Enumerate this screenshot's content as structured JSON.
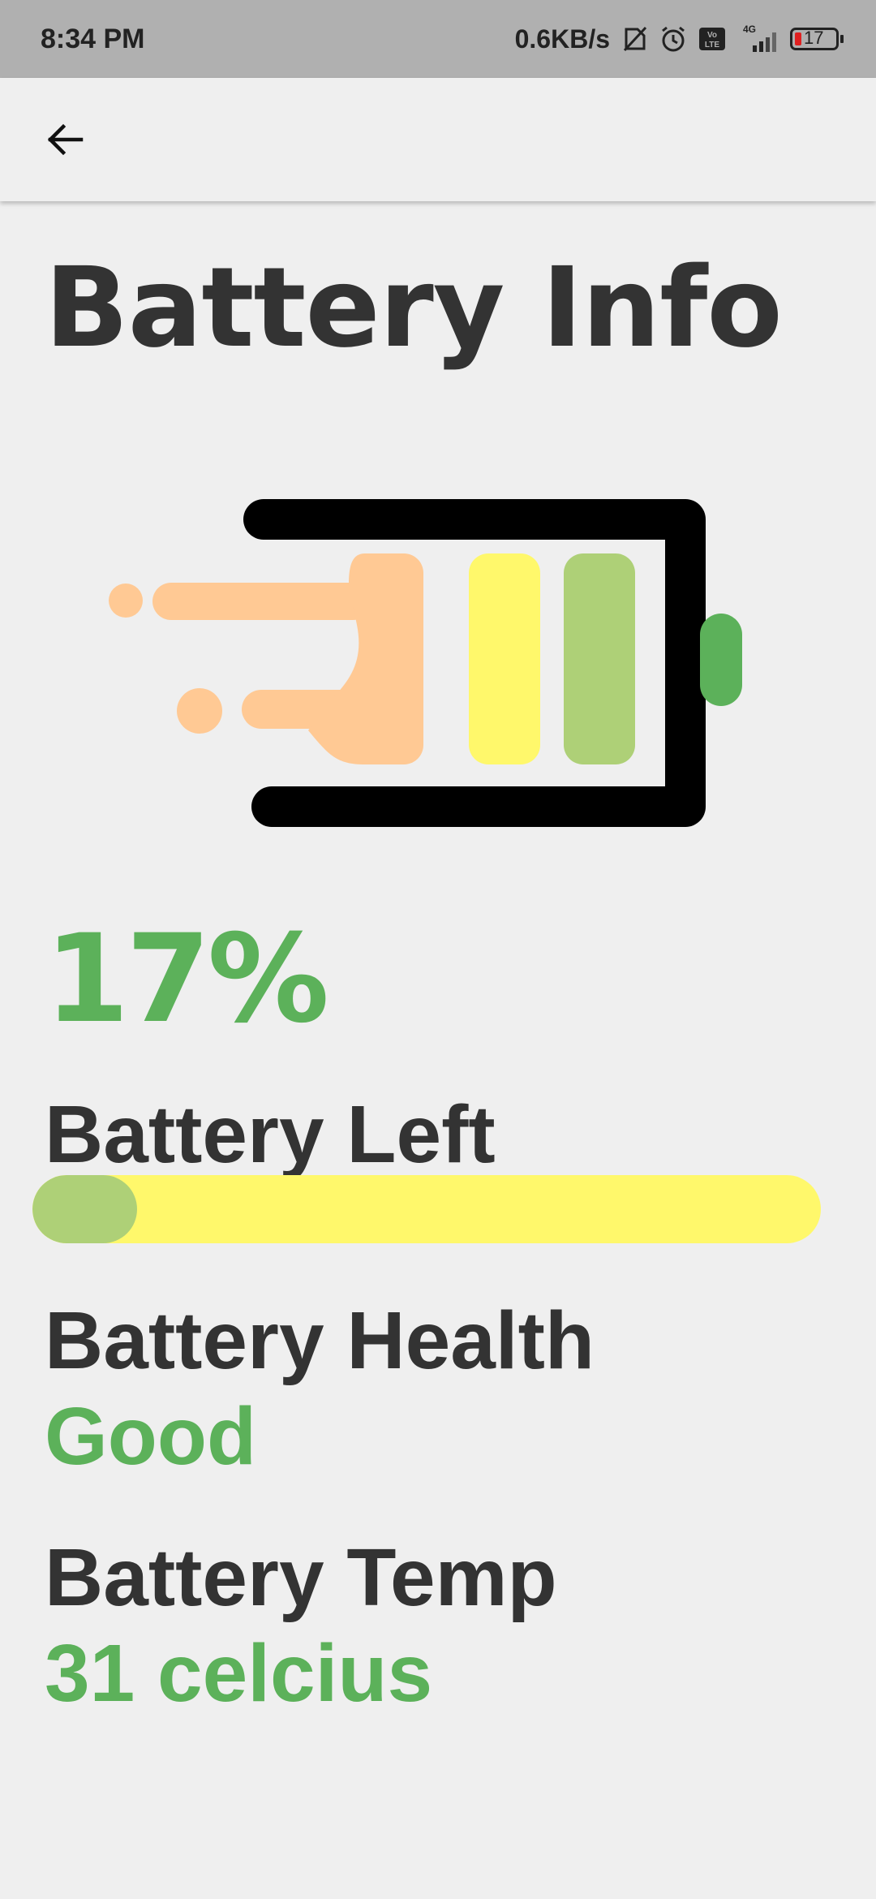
{
  "status_bar": {
    "time": "8:34 PM",
    "network_speed": "0.6KB/s",
    "network_type": "4G",
    "volte_label": "Vo LTE",
    "battery_level": "17",
    "icons": [
      "no-sim-icon",
      "alarm-icon",
      "volte-icon",
      "signal-icon",
      "battery-icon"
    ]
  },
  "app_bar": {
    "back_icon": "arrow-left-icon"
  },
  "page": {
    "title": "Battery Info"
  },
  "battery": {
    "percent_text": "17%",
    "percent_fraction": 0.17,
    "left_label": "Battery Left",
    "health_label": "Battery Health",
    "health_value": "Good",
    "temp_label": "Battery Temp",
    "temp_value": "31 celcius"
  },
  "colors": {
    "accent_green": "#5cb15a",
    "bar_track_yellow": "#fff86b",
    "bar_fill_green": "#aed077",
    "title_gray": "#333333",
    "hand_peach": "#ffc994",
    "status_battery_red": "#e02020"
  }
}
